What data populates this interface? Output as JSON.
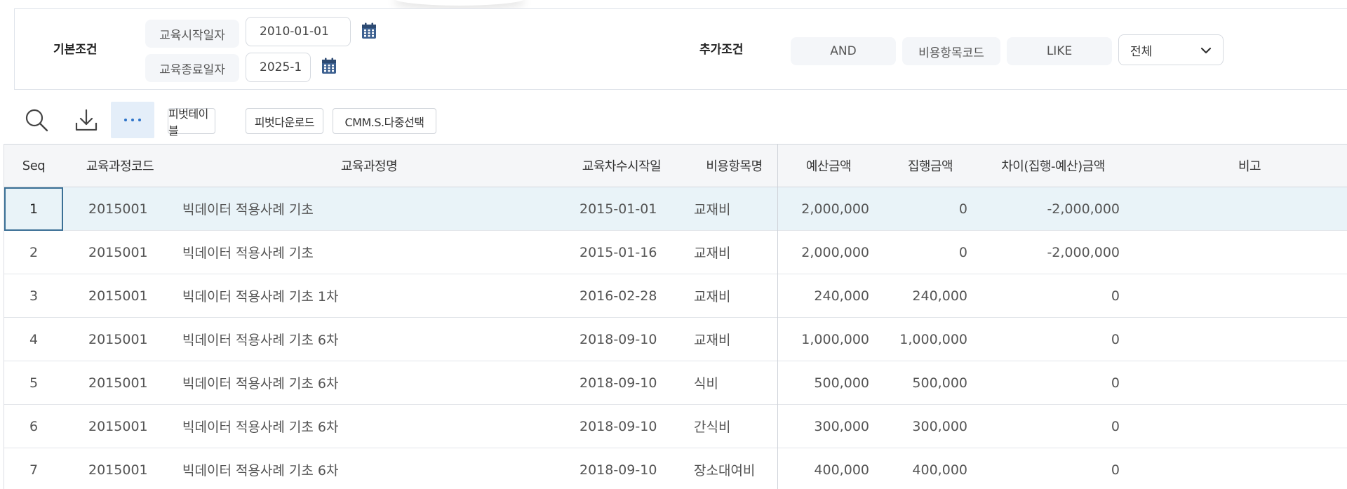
{
  "search": {
    "basic_title": "기본조건",
    "start_label": "교육시작일자",
    "start_value": "2010-01-01",
    "end_label": "교육종료일자",
    "end_value": "2025-1",
    "extra_title": "추가조건",
    "operator": "AND",
    "field": "비용항목코드",
    "match": "LIKE",
    "select_value": "전체"
  },
  "toolbar": {
    "pivot_table": "피벗테이블",
    "pivot_download": "피벗다운로드",
    "multi_select": "CMM.S.다중선택"
  },
  "grid": {
    "columns": [
      "Seq",
      "교육과정코드",
      "교육과정명",
      "교육차수시작일",
      "비용항목명",
      "예산금액",
      "집행금액",
      "차이(집행-예산)금액",
      "비고"
    ],
    "rows": [
      {
        "seq": "1",
        "code": "2015001",
        "name": "빅데이터 적용사례 기초",
        "date": "2015-01-01",
        "item": "교재비",
        "budget": "2,000,000",
        "exec": "0",
        "diff": "-2,000,000",
        "note": ""
      },
      {
        "seq": "2",
        "code": "2015001",
        "name": "빅데이터 적용사례 기초",
        "date": "2015-01-16",
        "item": "교재비",
        "budget": "2,000,000",
        "exec": "0",
        "diff": "-2,000,000",
        "note": ""
      },
      {
        "seq": "3",
        "code": "2015001",
        "name": "빅데이터 적용사례 기초 1차",
        "date": "2016-02-28",
        "item": "교재비",
        "budget": "240,000",
        "exec": "240,000",
        "diff": "0",
        "note": ""
      },
      {
        "seq": "4",
        "code": "2015001",
        "name": "빅데이터 적용사례 기초 6차",
        "date": "2018-09-10",
        "item": "교재비",
        "budget": "1,000,000",
        "exec": "1,000,000",
        "diff": "0",
        "note": ""
      },
      {
        "seq": "5",
        "code": "2015001",
        "name": "빅데이터 적용사례 기초 6차",
        "date": "2018-09-10",
        "item": "식비",
        "budget": "500,000",
        "exec": "500,000",
        "diff": "0",
        "note": ""
      },
      {
        "seq": "6",
        "code": "2015001",
        "name": "빅데이터 적용사례 기초 6차",
        "date": "2018-09-10",
        "item": "간식비",
        "budget": "300,000",
        "exec": "300,000",
        "diff": "0",
        "note": ""
      },
      {
        "seq": "7",
        "code": "2015001",
        "name": "빅데이터 적용사례 기초 6차",
        "date": "2018-09-10",
        "item": "장소대여비",
        "budget": "400,000",
        "exec": "400,000",
        "diff": "0",
        "note": ""
      }
    ]
  },
  "colors": {
    "accent": "#2c73c9",
    "selected_row": "#e9f3f8",
    "focus_border": "#3a6f95"
  }
}
